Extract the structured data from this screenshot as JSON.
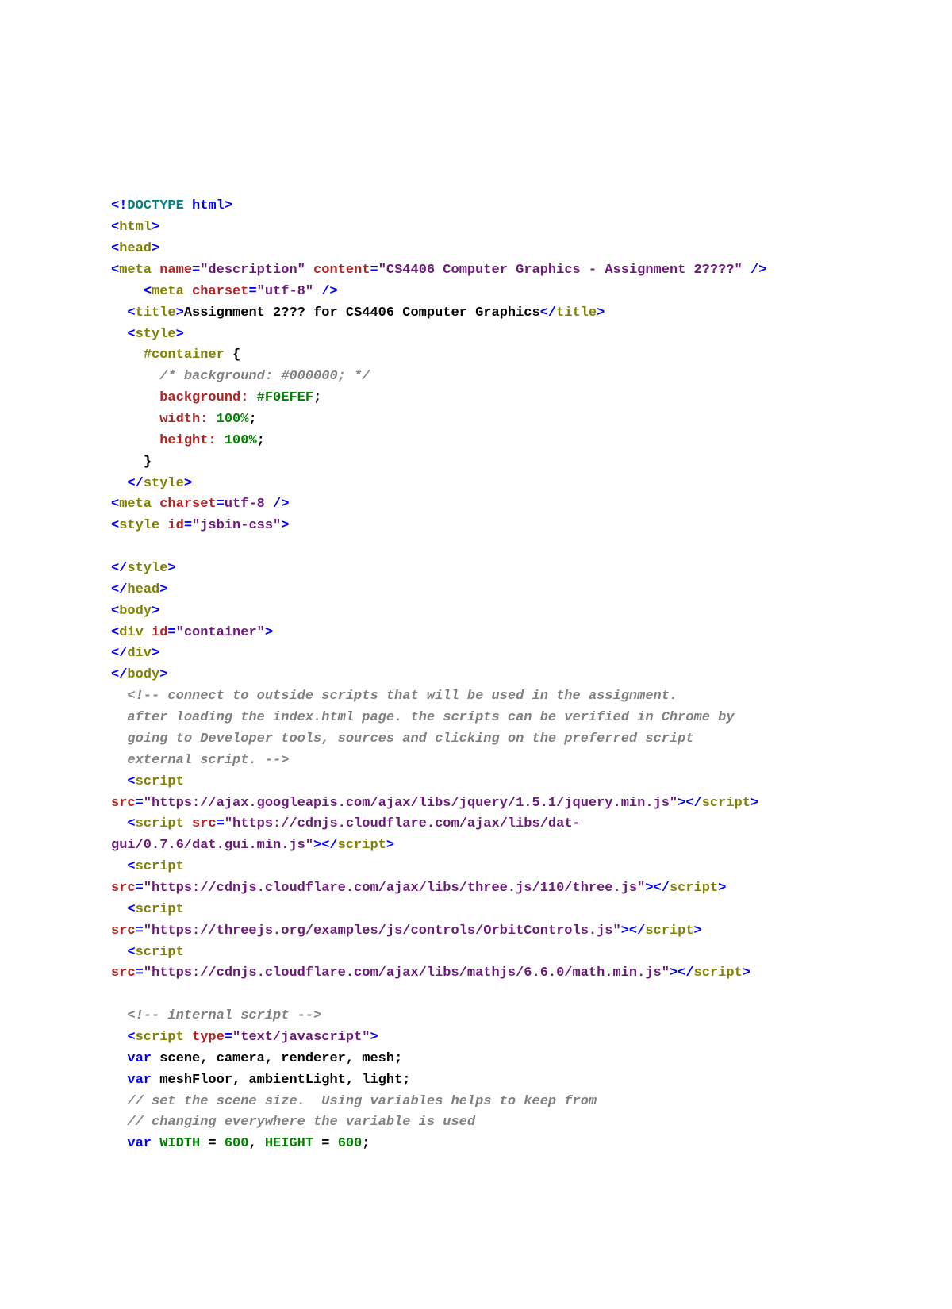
{
  "lines": {
    "l01_lt": "<",
    "l01_bang": "!",
    "l01_doctype": "DOCTYPE ",
    "l01_html": "html",
    "l01_gt": ">",
    "l02_lt": "<",
    "l02_tag": "html",
    "l02_gt": ">",
    "l03_lt": "<",
    "l03_tag": "head",
    "l03_gt": ">",
    "l04_lt": "<",
    "l04_tag": "meta",
    "l04_sp": " ",
    "l04_a1": "name",
    "l04_eq1": "=",
    "l04_v1": "\"description\"",
    "l04_sp2": " ",
    "l04_a2": "content",
    "l04_eq2": "=",
    "l04_v2": "\"CS4406 Computer Graphics - Assignment 2????\"",
    "l04_end": " />",
    "l05_pre": "    ",
    "l05_lt": "<",
    "l05_tag": "meta",
    "l05_sp": " ",
    "l05_a1": "charset",
    "l05_eq": "=",
    "l05_v1": "\"utf-8\"",
    "l05_end": " />",
    "l06_pre": "  ",
    "l06_lt": "<",
    "l06_tag": "title",
    "l06_gt": ">",
    "l06_text": "Assignment 2??? for CS4406 Computer Graphics",
    "l06_lt2": "</",
    "l06_tag2": "title",
    "l06_gt2": ">",
    "l07_pre": "  ",
    "l07_lt": "<",
    "l07_tag": "style",
    "l07_gt": ">",
    "l08_pre": "    ",
    "l08_sel": "#container",
    "l08_brace": " {",
    "l09_pre": "      ",
    "l09_cmt": "/* background: #000000; */",
    "l10_pre": "      ",
    "l10_p": "background:",
    "l10_v": " #F0EFEF",
    "l10_sc": ";",
    "l11_pre": "      ",
    "l11_p": "width:",
    "l11_v": " 100%",
    "l11_sc": ";",
    "l12_pre": "      ",
    "l12_p": "height:",
    "l12_v": " 100%",
    "l12_sc": ";",
    "l13_pre": "    ",
    "l13_brace": "}",
    "l14_pre": "  ",
    "l14_lt": "</",
    "l14_tag": "style",
    "l14_gt": ">",
    "l15_lt": "<",
    "l15_tag": "meta",
    "l15_sp": " ",
    "l15_a": "charset",
    "l15_eq": "=",
    "l15_v": "utf-8",
    "l15_end": " />",
    "l16_lt": "<",
    "l16_tag": "style",
    "l16_sp": " ",
    "l16_a": "id",
    "l16_eq": "=",
    "l16_v": "\"jsbin-css\"",
    "l16_gt": ">",
    "l17_blank": "",
    "l18_lt": "</",
    "l18_tag": "style",
    "l18_gt": ">",
    "l19_lt": "</",
    "l19_tag": "head",
    "l19_gt": ">",
    "l20_lt": "<",
    "l20_tag": "body",
    "l20_gt": ">",
    "l21_lt": "<",
    "l21_tag": "div",
    "l21_sp": " ",
    "l21_a": "id",
    "l21_eq": "=",
    "l21_v": "\"container\"",
    "l21_gt": ">",
    "l22_lt": "</",
    "l22_tag": "div",
    "l22_gt": ">",
    "l23_lt": "</",
    "l23_tag": "body",
    "l23_gt": ">",
    "l24_pre": "  ",
    "l24_cmt": "<!-- connect to outside scripts that will be used in the assignment.",
    "l25_pre": "  ",
    "l25_cmt": "after loading the index.html page. the scripts can be verified in Chrome by",
    "l26_pre": "  ",
    "l26_cmt": "going to Developer tools, sources and clicking on the preferred script",
    "l27_pre": "  ",
    "l27_cmt": "external script. -->",
    "l28_pre": "  ",
    "l28_lt": "<",
    "l28_tag": "script",
    "l29_a": "src",
    "l29_eq": "=",
    "l29_v": "\"https://ajax.googleapis.com/ajax/libs/jquery/1.5.1/jquery.min.js\"",
    "l29_gt": ">",
    "l29_lt2": "</",
    "l29_tag2": "script",
    "l29_gt2": ">",
    "l30_pre": "  ",
    "l30_lt": "<",
    "l30_tag": "script",
    "l30_sp": " ",
    "l30_a": "src",
    "l30_eq": "=",
    "l30_v": "\"https://cdnjs.cloudflare.com/ajax/libs/dat-",
    "l31_v": "gui/0.7.6/dat.gui.min.js\"",
    "l31_gt": ">",
    "l31_lt2": "</",
    "l31_tag2": "script",
    "l31_gt2": ">",
    "l32_pre": "  ",
    "l32_lt": "<",
    "l32_tag": "script",
    "l33_a": "src",
    "l33_eq": "=",
    "l33_v": "\"https://cdnjs.cloudflare.com/ajax/libs/three.js/110/three.js\"",
    "l33_gt": ">",
    "l33_lt2": "</",
    "l33_tag2": "script",
    "l33_gt2": ">",
    "l34_pre": "  ",
    "l34_lt": "<",
    "l34_tag": "script",
    "l35_a": "src",
    "l35_eq": "=",
    "l35_v": "\"https://threejs.org/examples/js/controls/OrbitControls.js\"",
    "l35_gt": ">",
    "l35_lt2": "</",
    "l35_tag2": "script",
    "l35_gt2": ">",
    "l36_pre": "  ",
    "l36_lt": "<",
    "l36_tag": "script",
    "l37_a": "src",
    "l37_eq": "=",
    "l37_v": "\"https://cdnjs.cloudflare.com/ajax/libs/mathjs/6.6.0/math.min.js\"",
    "l37_gt": ">",
    "l37_lt2": "</",
    "l37_tag2": "script",
    "l37_gt2": ">",
    "l38_blank": "",
    "l39_pre": "  ",
    "l39_cmt": "<!-- internal script -->",
    "l40_pre": "  ",
    "l40_lt": "<",
    "l40_tag": "script",
    "l40_sp": " ",
    "l40_a": "type",
    "l40_eq": "=",
    "l40_v": "\"text/javascript\"",
    "l40_gt": ">",
    "l41_pre": "  ",
    "l41_kw": "var",
    "l41_vars": " scene, camera, renderer, mesh;",
    "l42_pre": "  ",
    "l42_kw": "var",
    "l42_vars": " meshFloor, ambientLight, light;",
    "l43_pre": "  ",
    "l43_cmt": "// set the scene size.  Using variables helps to keep from",
    "l44_pre": "  ",
    "l44_cmt": "// changing everywhere the variable is used",
    "l45_pre": "  ",
    "l45_kw": "var",
    "l45_sp": " ",
    "l45_n1": "WIDTH",
    "l45_eq1": " = ",
    "l45_v1": "600",
    "l45_c": ", ",
    "l45_n2": "HEIGHT",
    "l45_eq2": " = ",
    "l45_v2": "600",
    "l45_sc": ";"
  }
}
